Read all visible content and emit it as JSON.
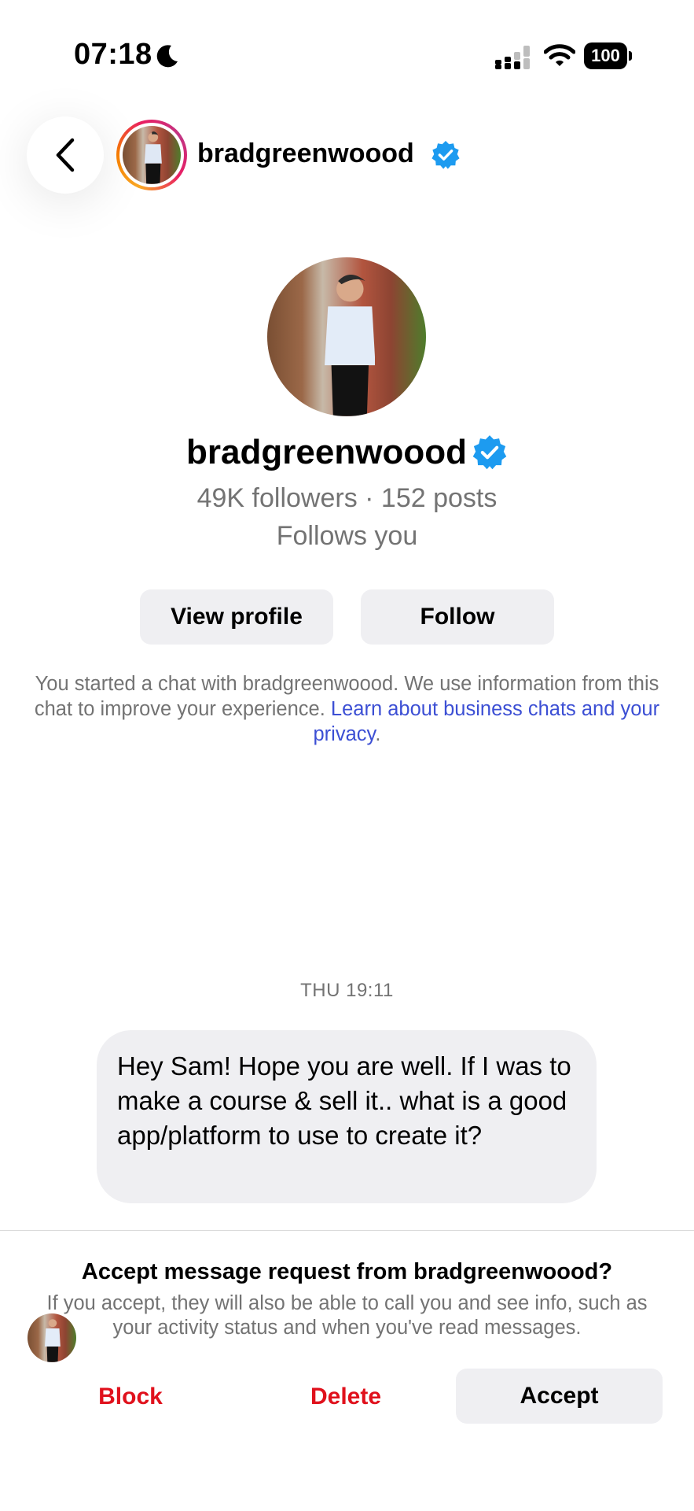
{
  "status_bar": {
    "time": "07:18",
    "battery": "100"
  },
  "header": {
    "username": "bradgreenwoood"
  },
  "profile": {
    "name": "bradgreenwoood",
    "stats": "49K followers · 152 posts",
    "follows_status": "Follows you",
    "view_profile_label": "View profile",
    "follow_label": "Follow"
  },
  "disclaimer": {
    "text": "You started a chat with bradgreenwoood. We use information from this chat to improve your experience. ",
    "link_text": "Learn about business chats and your privacy",
    "end": "."
  },
  "chat": {
    "timestamp": "THU 19:11",
    "messages": [
      {
        "sender": "bradgreenwoood",
        "text": "Hey Sam! Hope you are well. If I was to make a course & sell it.. what is a good app/platform to use to create it?"
      }
    ]
  },
  "request": {
    "title": "Accept message request from bradgreenwoood?",
    "subtitle": "If you accept, they will also be able to call you and see info, such as your activity status and when you've read messages.",
    "block_label": "Block",
    "delete_label": "Delete",
    "accept_label": "Accept"
  },
  "colors": {
    "verified": "#1d9bf0",
    "danger": "#e0111c",
    "link": "#3c4fd4",
    "muted": "#737373",
    "button_bg": "#efeff2"
  },
  "icons": [
    "moon-icon",
    "cellular-signal-icon",
    "wifi-icon",
    "battery-icon",
    "back-chevron-icon",
    "verified-badge-icon"
  ]
}
